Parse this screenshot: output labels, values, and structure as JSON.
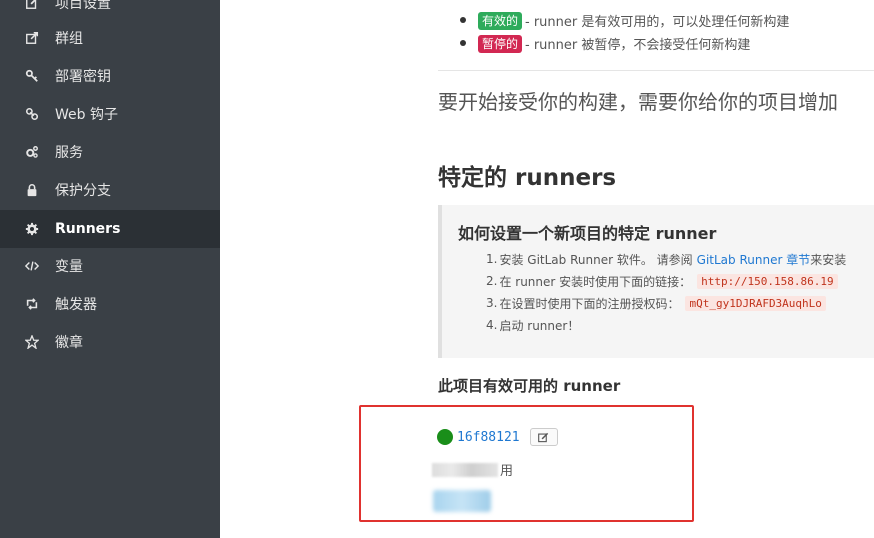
{
  "sidebar": {
    "items": [
      {
        "label": "项目设置",
        "icon": "edit-icon"
      },
      {
        "label": "群组",
        "icon": "share-icon"
      },
      {
        "label": "部署密钥",
        "icon": "key-icon"
      },
      {
        "label": "Web 钩子",
        "icon": "link-icon"
      },
      {
        "label": "服务",
        "icon": "cogs-icon"
      },
      {
        "label": "保护分支",
        "icon": "lock-icon"
      },
      {
        "label": "Runners",
        "icon": "gear-icon",
        "active": true
      },
      {
        "label": "变量",
        "icon": "code-icon"
      },
      {
        "label": "触发器",
        "icon": "retweet-icon"
      },
      {
        "label": "徽章",
        "icon": "star-icon"
      }
    ]
  },
  "status": {
    "active_badge": "有效的",
    "active_desc": "- runner 是有效可用的，可以处理任何新构建",
    "paused_badge": "暂停的",
    "paused_desc": "- runner 被暂停，不会接受任何新构建"
  },
  "intro_text": "要开始接受你的构建，需要你给你的项目增加",
  "specific_runners_title": "特定的 runners",
  "setup": {
    "title": "如何设置一个新项目的特定 runner",
    "step1_prefix": "安装 GitLab Runner 软件。 请参阅",
    "step1_link": "GitLab Runner 章节",
    "step1_suffix": "来安装",
    "step2_text": "在 runner 安装时使用下面的链接：",
    "step2_code": "http://150.158.86.19",
    "step3_text": "在设置时使用下面的注册授权码：",
    "step3_code": "mQt_gy1DJRAFD3AuqhLo",
    "step4_text": "启动 runner！",
    "nums": [
      "1.",
      "2.",
      "3.",
      "4."
    ]
  },
  "available_title": "此项目有效可用的 runner",
  "runner": {
    "id": "16f88121",
    "status_color": "#1a8e1a",
    "desc_suffix": "用"
  },
  "colors": {
    "sidebar_bg": "#3a4046",
    "active_badge": "#2eab5b",
    "paused_badge": "#d22852",
    "link": "#1f78d1",
    "highlight_border": "#e0322f"
  }
}
